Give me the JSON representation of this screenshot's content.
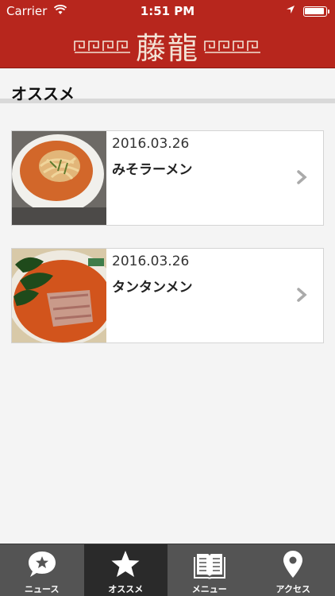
{
  "status_bar": {
    "carrier": "Carrier",
    "time": "1:51 PM"
  },
  "header": {
    "logo_text": "藤龍"
  },
  "section": {
    "title": "オススメ"
  },
  "items": [
    {
      "date": "2016.03.26",
      "name": "みそラーメン"
    },
    {
      "date": "2016.03.26",
      "name": "タンタンメン"
    }
  ],
  "tabs": [
    {
      "label": "ニュース",
      "icon": "chat-star-icon",
      "active": false
    },
    {
      "label": "オススメ",
      "icon": "star-icon",
      "active": true
    },
    {
      "label": "メニュー",
      "icon": "book-icon",
      "active": false
    },
    {
      "label": "アクセス",
      "icon": "location-pin-icon",
      "active": false
    }
  ],
  "colors": {
    "header_red": "#b7261d",
    "tabbar": "#545454",
    "tab_active": "#2a2a2a"
  }
}
